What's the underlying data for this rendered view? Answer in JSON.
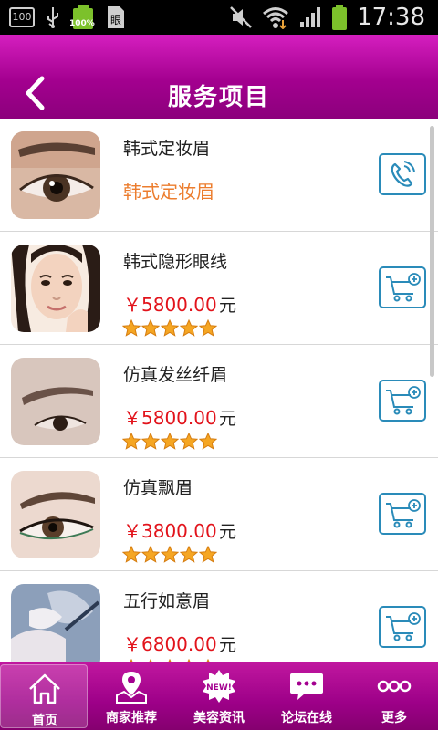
{
  "status_bar": {
    "battery_badge": "100",
    "battery_percent": "100%",
    "time": "17:38"
  },
  "header": {
    "title": "服务项目"
  },
  "items": [
    {
      "name": "韩式定妆眉",
      "subtitle": "韩式定妆眉",
      "action_icon": "phone-icon"
    },
    {
      "name": "韩式隐形眼线",
      "price": "￥5800.00",
      "unit": "元",
      "rating": 5,
      "action_icon": "cart-icon"
    },
    {
      "name": "仿真发丝纤眉",
      "price": "￥5800.00",
      "unit": "元",
      "rating": 5,
      "action_icon": "cart-icon"
    },
    {
      "name": "仿真飘眉",
      "price": "￥3800.00",
      "unit": "元",
      "rating": 5,
      "action_icon": "cart-icon"
    },
    {
      "name": "五行如意眉",
      "price": "￥6800.00",
      "unit": "元",
      "rating": 5,
      "action_icon": "cart-icon"
    }
  ],
  "bottom_nav": [
    {
      "label": "首页",
      "icon": "home-icon",
      "active": true
    },
    {
      "label": "商家推荐",
      "icon": "map-pin-icon"
    },
    {
      "label": "美容资讯",
      "icon": "new-badge-icon",
      "badge_text": "NEW!"
    },
    {
      "label": "论坛在线",
      "icon": "chat-bubble-icon"
    },
    {
      "label": "更多",
      "icon": "more-dots-icon"
    }
  ],
  "colors": {
    "header_magenta": "#a3008f",
    "price_red": "#e2131b",
    "subtitle_orange": "#ec7d2e",
    "action_blue": "#2a8bb9",
    "star_gold": "#f5a623"
  }
}
